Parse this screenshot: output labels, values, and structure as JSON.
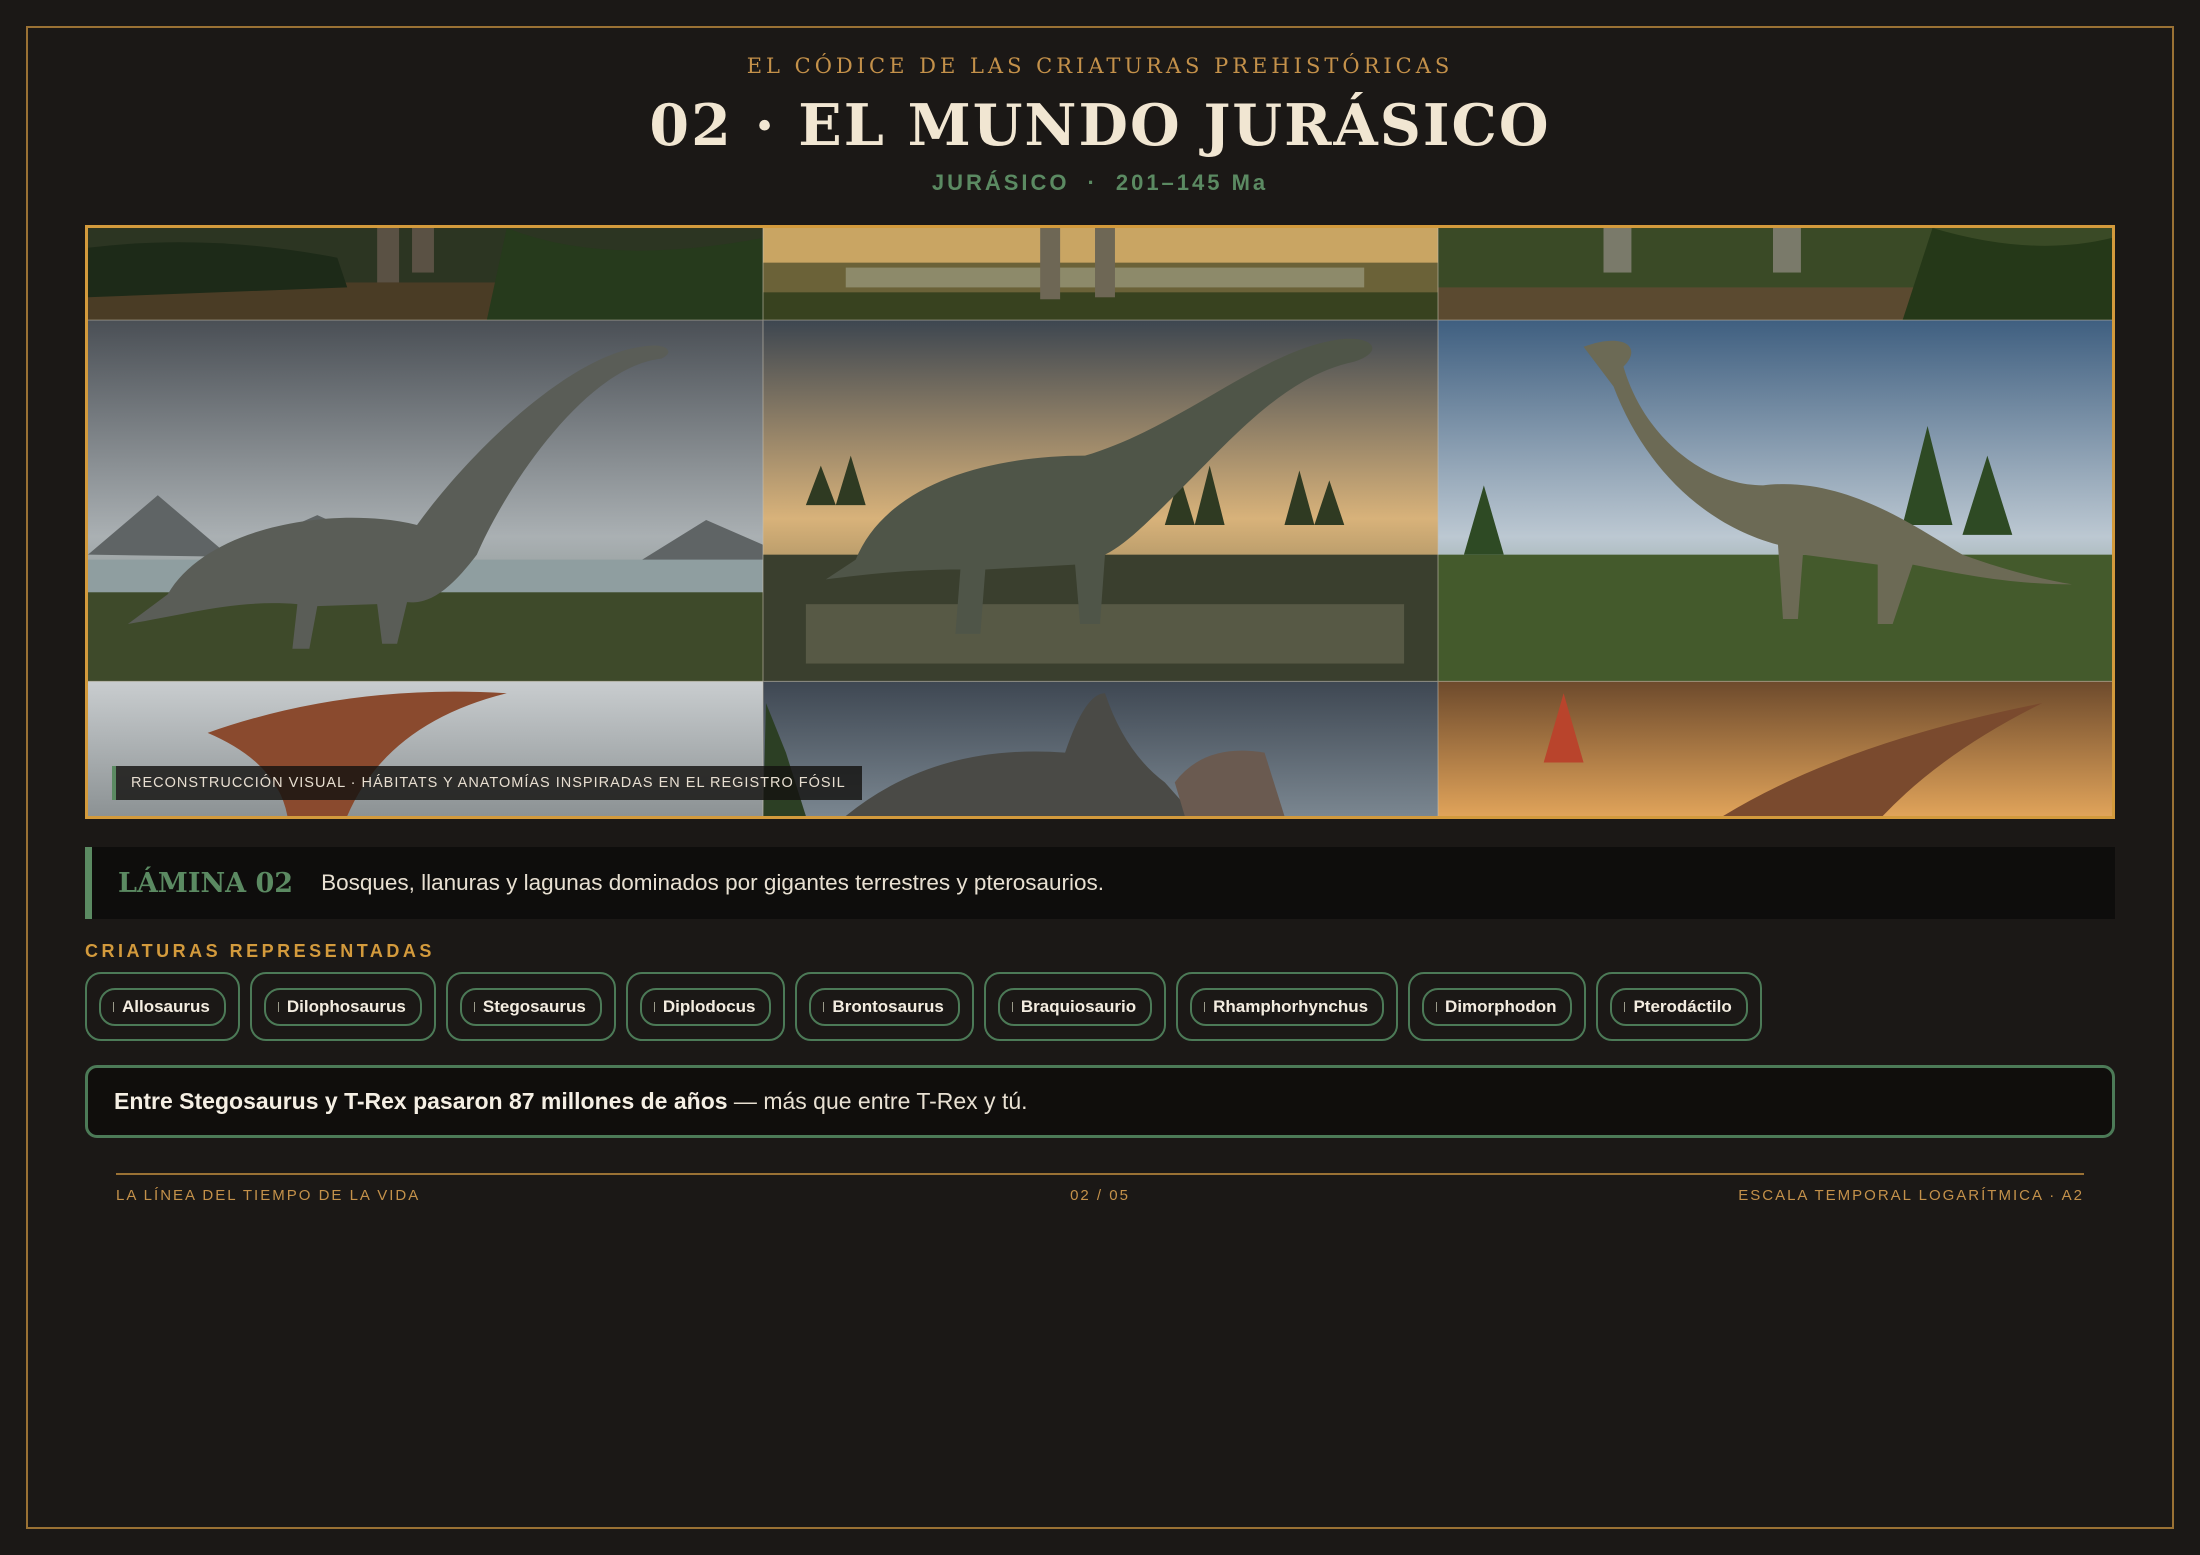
{
  "header": {
    "kicker": "EL CÓDICE DE LAS CRIATURAS PREHISTÓRICAS",
    "title": "02 · EL MUNDO JURÁSICO",
    "period": "JURÁSICO",
    "separator": "·",
    "range": "201–145 Ma"
  },
  "gallery": {
    "caption": "RECONSTRUCCIÓN VISUAL · HÁBITATS Y ANATOMÍAS INSPIRADAS EN EL REGISTRO FÓSIL"
  },
  "lamina": {
    "label": "LÁMINA 02",
    "text": "Bosques, llanuras y lagunas dominados por gigantes terrestres y pterosaurios."
  },
  "creatures": {
    "heading": "CRIATURAS REPRESENTADAS",
    "items": [
      "Allosaurus",
      "Dilophosaurus",
      "Stegosaurus",
      "Diplodocus",
      "Brontosaurus",
      "Braquiosaurio",
      "Rhamphorhynchus",
      "Dimorphodon",
      "Pterodáctilo"
    ]
  },
  "fact": {
    "bold": "Entre Stegosaurus y T-Rex pasaron 87 millones de años",
    "rest": " — más que entre T-Rex y tú."
  },
  "footer": {
    "left": "LA LÍNEA DEL TIEMPO DE LA VIDA",
    "center": "02 / 05",
    "right": "ESCALA TEMPORAL LOGARÍTMICA · A2"
  },
  "colors": {
    "background": "#1b1816",
    "gold": "#c4914a",
    "accent_green": "#5b8a62",
    "frame_gold": "#d39a3c"
  }
}
